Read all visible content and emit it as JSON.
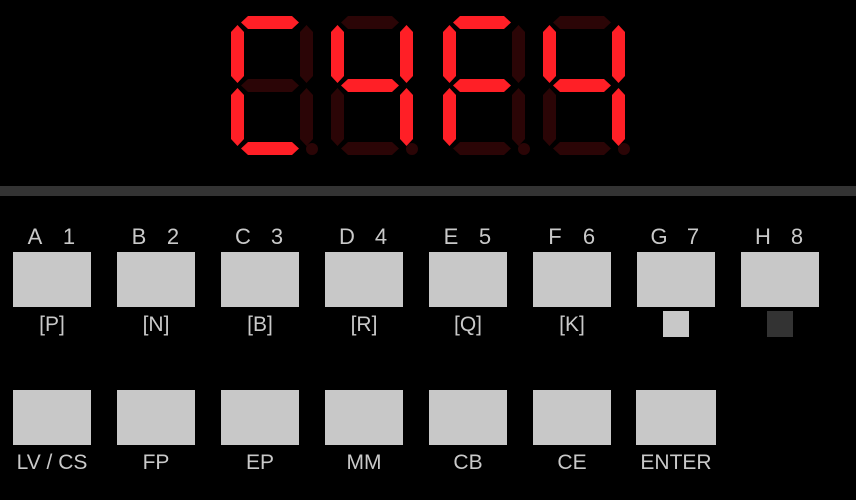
{
  "device": {
    "title": "seven-segment keypad panel",
    "background_color": "#000000",
    "divider_color": "#333333",
    "button_color": "#c8c8c8",
    "label_color": "#c9c9c9"
  },
  "display": {
    "type": "seven-segment",
    "digit_count": 4,
    "segment_on_color": "#ff1f26",
    "segment_off_color": "#2b0506",
    "reading": "C4F4",
    "digits": [
      {
        "index": 0,
        "character": "C",
        "segments": {
          "a": true,
          "b": false,
          "c": false,
          "d": true,
          "e": true,
          "f": true,
          "g": false
        },
        "decimal_point": false
      },
      {
        "index": 1,
        "character": "4",
        "segments": {
          "a": false,
          "b": true,
          "c": true,
          "d": false,
          "e": false,
          "f": true,
          "g": true
        },
        "decimal_point": false
      },
      {
        "index": 2,
        "character": "F",
        "segments": {
          "a": true,
          "b": false,
          "c": false,
          "d": false,
          "e": true,
          "f": true,
          "g": true
        },
        "decimal_point": false
      },
      {
        "index": 3,
        "character": "4",
        "segments": {
          "a": false,
          "b": true,
          "c": true,
          "d": false,
          "e": false,
          "f": true,
          "g": true
        },
        "decimal_point": false
      }
    ]
  },
  "keypad": {
    "top_row": [
      {
        "letter": "A",
        "number": "1",
        "bottom_label": "[P]",
        "indicator": null
      },
      {
        "letter": "B",
        "number": "2",
        "bottom_label": "[N]",
        "indicator": null
      },
      {
        "letter": "C",
        "number": "3",
        "bottom_label": "[B]",
        "indicator": null
      },
      {
        "letter": "D",
        "number": "4",
        "bottom_label": "[R]",
        "indicator": null
      },
      {
        "letter": "E",
        "number": "5",
        "bottom_label": "[Q]",
        "indicator": null
      },
      {
        "letter": "F",
        "number": "6",
        "bottom_label": "[K]",
        "indicator": null
      },
      {
        "letter": "G",
        "number": "7",
        "bottom_label": "",
        "indicator": "on"
      },
      {
        "letter": "H",
        "number": "8",
        "bottom_label": "",
        "indicator": "off"
      }
    ],
    "bottom_row": [
      {
        "label": "LV / CS"
      },
      {
        "label": "FP"
      },
      {
        "label": "EP"
      },
      {
        "label": "MM"
      },
      {
        "label": "CB"
      },
      {
        "label": "CE"
      },
      {
        "label": "ENTER"
      }
    ]
  }
}
